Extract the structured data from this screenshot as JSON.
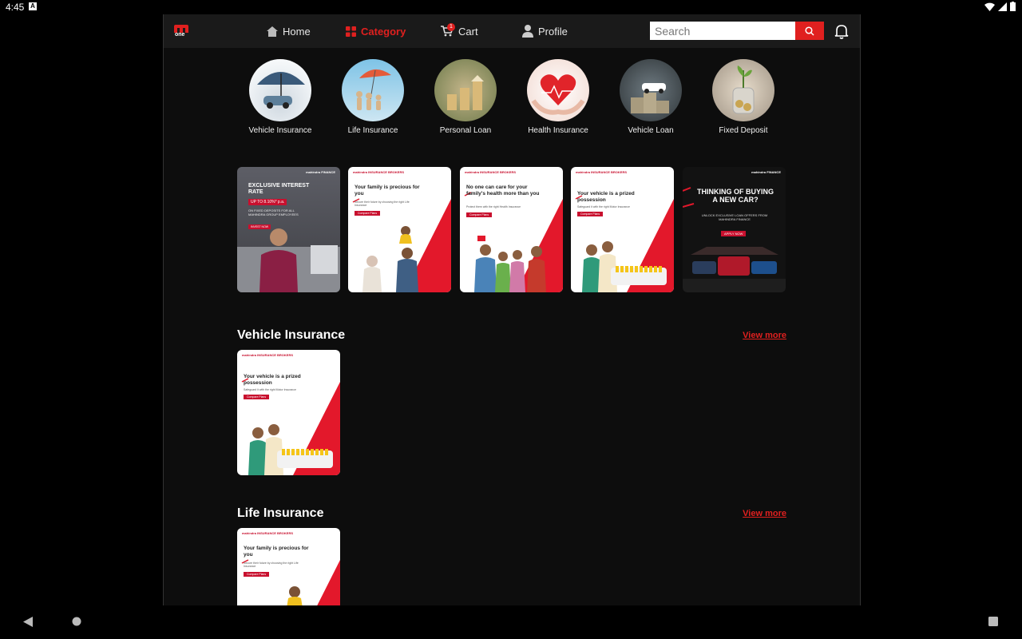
{
  "status": {
    "time": "4:45",
    "a_badge": "A"
  },
  "nav": {
    "logo_text": "one",
    "items": [
      {
        "label": "Home",
        "icon": "home-icon"
      },
      {
        "label": "Category",
        "icon": "grid-icon",
        "active": true
      },
      {
        "label": "Cart",
        "icon": "cart-icon",
        "badge": "1"
      },
      {
        "label": "Profile",
        "icon": "person-icon"
      }
    ],
    "search_placeholder": "Search"
  },
  "categories": [
    {
      "label": "Vehicle Insurance"
    },
    {
      "label": "Life Insurance"
    },
    {
      "label": "Personal Loan"
    },
    {
      "label": "Health Insurance"
    },
    {
      "label": "Vehicle Loan"
    },
    {
      "label": "Fixed Deposit"
    }
  ],
  "banners": [
    {
      "brand": "mahindra FINANCE",
      "headline": "EXCLUSIVE INTEREST RATE",
      "rate": "UP TO 8.10%* p.a.",
      "sub": "ON FIXED DEPOSITS FOR ALL MAHINDRA GROUP EMPLOYEES",
      "cta": "INVEST NOW"
    },
    {
      "brand": "mahindra INSURANCE BROKERS",
      "headline": "Your family is precious for you",
      "sub": "Secure their future by choosing the right Life Insurance",
      "cta": "Compare Plans"
    },
    {
      "brand": "mahindra INSURANCE BROKERS",
      "headline": "No one can care for your family's health more than you",
      "sub": "Protect them with the right Health Insurance",
      "cta": "Compare Plans"
    },
    {
      "brand": "mahindra INSURANCE BROKERS",
      "headline": "Your vehicle is a prized possession",
      "sub": "Safeguard it with the right Motor Insurance",
      "cta": "Compare Plans"
    },
    {
      "brand": "mahindra FINANCE",
      "headline": "THINKING OF BUYING A NEW CAR?",
      "sub": "UNLOCK EXCLUSIVE LOAN OFFERS FROM MAHINDRA FINANCE",
      "cta": "APPLY NOW"
    }
  ],
  "sections": [
    {
      "title": "Vehicle Insurance",
      "view_more": "View more",
      "card": {
        "brand": "mahindra INSURANCE BROKERS",
        "headline": "Your vehicle is a prized possession",
        "sub": "Safeguard it with the right Motor Insurance",
        "cta": "Compare Plans"
      }
    },
    {
      "title": "Life Insurance",
      "view_more": "View more",
      "card": {
        "brand": "mahindra INSURANCE BROKERS",
        "headline": "Your family is precious for you",
        "sub": "Secure their future by choosing the right Life Insurance",
        "cta": "Compare Plans"
      }
    }
  ],
  "colors": {
    "accent": "#e0201f",
    "nav_bg": "#1a1a1a",
    "page_bg": "#0d0d0d"
  }
}
